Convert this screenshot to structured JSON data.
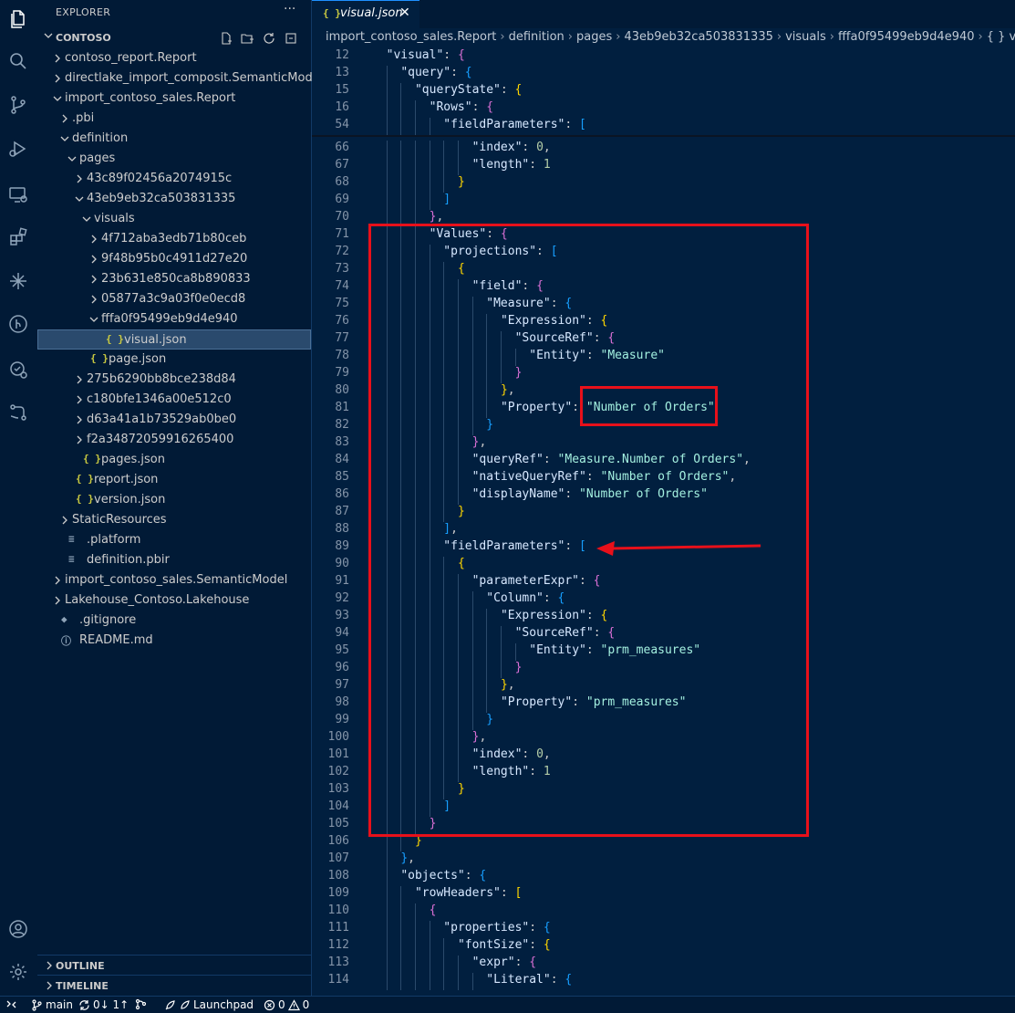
{
  "sidebar": {
    "title": "EXPLORER",
    "more": "···",
    "folder": "CONTOSO",
    "items": [
      {
        "label": "contoso_report.Report",
        "chev": "right",
        "indent": 0
      },
      {
        "label": "directlake_import_composit.SemanticModel",
        "chev": "right",
        "indent": 0
      },
      {
        "label": "import_contoso_sales.Report",
        "chev": "down",
        "indent": 0
      },
      {
        "label": ".pbi",
        "chev": "right",
        "indent": 1
      },
      {
        "label": "definition",
        "chev": "down",
        "indent": 1
      },
      {
        "label": "pages",
        "chev": "down",
        "indent": 2
      },
      {
        "label": "43c89f02456a2074915c",
        "chev": "right",
        "indent": 3
      },
      {
        "label": "43eb9eb32ca503831335",
        "chev": "down",
        "indent": 3
      },
      {
        "label": "visuals",
        "chev": "down",
        "indent": 4
      },
      {
        "label": "4f712aba3edb71b80ceb",
        "chev": "right",
        "indent": 5
      },
      {
        "label": "9f48b95b0c4911d27e20",
        "chev": "right",
        "indent": 5
      },
      {
        "label": "23b631e850ca8b890833",
        "chev": "right",
        "indent": 5
      },
      {
        "label": "05877a3c9a03f0e0ecd8",
        "chev": "right",
        "indent": 5
      },
      {
        "label": "fffa0f95499eb9d4e940",
        "chev": "down",
        "indent": 5
      },
      {
        "label": "visual.json",
        "icon": "{ }",
        "indent": 6,
        "selected": true
      },
      {
        "label": "page.json",
        "icon": "{ }",
        "indent": 4
      },
      {
        "label": "275b6290bb8bce238d84",
        "chev": "right",
        "indent": 3
      },
      {
        "label": "c180bfe1346a00e512c0",
        "chev": "right",
        "indent": 3
      },
      {
        "label": "d63a41a1b73529ab0be0",
        "chev": "right",
        "indent": 3
      },
      {
        "label": "f2a34872059916265400",
        "chev": "right",
        "indent": 3
      },
      {
        "label": "pages.json",
        "icon": "{ }",
        "indent": 3
      },
      {
        "label": "report.json",
        "icon": "{ }",
        "indent": 2
      },
      {
        "label": "version.json",
        "icon": "{ }",
        "indent": 2
      },
      {
        "label": "StaticResources",
        "chev": "right",
        "indent": 1
      },
      {
        "label": ".platform",
        "icon": "≡",
        "indent": 1
      },
      {
        "label": "definition.pbir",
        "icon": "≡",
        "indent": 1
      },
      {
        "label": "import_contoso_sales.SemanticModel",
        "chev": "right",
        "indent": 0
      },
      {
        "label": "Lakehouse_Contoso.Lakehouse",
        "chev": "right",
        "indent": 0
      },
      {
        "label": ".gitignore",
        "icon": "◆",
        "indent": 0
      },
      {
        "label": "README.md",
        "icon": "ⓘ",
        "indent": 0
      }
    ],
    "outline": "OUTLINE",
    "timeline": "TIMELINE"
  },
  "editor": {
    "tab": {
      "icon": "{ }",
      "label": "visual.json",
      "close": "✕"
    },
    "breadcrumbs": [
      "import_contoso_sales.Report",
      "definition",
      "pages",
      "43eb9eb32ca503831335",
      "visuals",
      "fffa0f95499eb9d4e940",
      "{ } visual.json",
      "…"
    ],
    "sticky_lines": [
      {
        "num": "12",
        "indent": 1,
        "parts": [
          [
            "k",
            "\"visual\""
          ],
          [
            "p",
            ": "
          ],
          [
            "b2",
            "{"
          ]
        ]
      },
      {
        "num": "13",
        "indent": 2,
        "parts": [
          [
            "k",
            "\"query\""
          ],
          [
            "p",
            ": "
          ],
          [
            "b3",
            "{"
          ]
        ]
      },
      {
        "num": "15",
        "indent": 3,
        "parts": [
          [
            "k",
            "\"queryState\""
          ],
          [
            "p",
            ": "
          ],
          [
            "b1",
            "{"
          ]
        ]
      },
      {
        "num": "16",
        "indent": 4,
        "parts": [
          [
            "k",
            "\"Rows\""
          ],
          [
            "p",
            ": "
          ],
          [
            "b2",
            "{"
          ]
        ]
      },
      {
        "num": "54",
        "indent": 5,
        "parts": [
          [
            "k",
            "\"fieldParameters\""
          ],
          [
            "p",
            ": "
          ],
          [
            "b3",
            "["
          ]
        ]
      }
    ],
    "lines": [
      {
        "num": "66",
        "indent": 7,
        "parts": [
          [
            "k",
            "\"index\""
          ],
          [
            "p",
            ": "
          ],
          [
            "n",
            "0"
          ],
          [
            "p",
            ","
          ]
        ]
      },
      {
        "num": "67",
        "indent": 7,
        "parts": [
          [
            "k",
            "\"length\""
          ],
          [
            "p",
            ": "
          ],
          [
            "n",
            "1"
          ]
        ]
      },
      {
        "num": "68",
        "indent": 6,
        "parts": [
          [
            "b1",
            "}"
          ]
        ]
      },
      {
        "num": "69",
        "indent": 5,
        "parts": [
          [
            "b3",
            "]"
          ]
        ]
      },
      {
        "num": "70",
        "indent": 4,
        "parts": [
          [
            "b2",
            "}"
          ],
          [
            "p",
            ","
          ]
        ]
      },
      {
        "num": "71",
        "indent": 4,
        "parts": [
          [
            "k",
            "\"Values\""
          ],
          [
            "p",
            ": "
          ],
          [
            "b2",
            "{"
          ]
        ]
      },
      {
        "num": "72",
        "indent": 5,
        "parts": [
          [
            "k",
            "\"projections\""
          ],
          [
            "p",
            ": "
          ],
          [
            "b3",
            "["
          ]
        ]
      },
      {
        "num": "73",
        "indent": 6,
        "parts": [
          [
            "b1",
            "{"
          ]
        ]
      },
      {
        "num": "74",
        "indent": 7,
        "parts": [
          [
            "k",
            "\"field\""
          ],
          [
            "p",
            ": "
          ],
          [
            "b2",
            "{"
          ]
        ]
      },
      {
        "num": "75",
        "indent": 8,
        "parts": [
          [
            "k",
            "\"Measure\""
          ],
          [
            "p",
            ": "
          ],
          [
            "b3",
            "{"
          ]
        ]
      },
      {
        "num": "76",
        "indent": 9,
        "parts": [
          [
            "k",
            "\"Expression\""
          ],
          [
            "p",
            ": "
          ],
          [
            "b1",
            "{"
          ]
        ]
      },
      {
        "num": "77",
        "indent": 10,
        "parts": [
          [
            "k",
            "\"SourceRef\""
          ],
          [
            "p",
            ": "
          ],
          [
            "b2",
            "{"
          ]
        ]
      },
      {
        "num": "78",
        "indent": 11,
        "parts": [
          [
            "k",
            "\"Entity\""
          ],
          [
            "p",
            ": "
          ],
          [
            "s",
            "\"Measure\""
          ]
        ]
      },
      {
        "num": "79",
        "indent": 10,
        "parts": [
          [
            "b2",
            "}"
          ]
        ]
      },
      {
        "num": "80",
        "indent": 9,
        "parts": [
          [
            "b1",
            "}"
          ],
          [
            "p",
            ","
          ]
        ]
      },
      {
        "num": "81",
        "indent": 9,
        "parts": [
          [
            "k",
            "\"Property\""
          ],
          [
            "p",
            ": "
          ],
          [
            "s",
            "\"Number of Orders\""
          ]
        ]
      },
      {
        "num": "82",
        "indent": 8,
        "parts": [
          [
            "b3",
            "}"
          ]
        ]
      },
      {
        "num": "83",
        "indent": 7,
        "parts": [
          [
            "b2",
            "}"
          ],
          [
            "p",
            ","
          ]
        ]
      },
      {
        "num": "84",
        "indent": 7,
        "parts": [
          [
            "k",
            "\"queryRef\""
          ],
          [
            "p",
            ": "
          ],
          [
            "s",
            "\"Measure.Number of Orders\""
          ],
          [
            "p",
            ","
          ]
        ]
      },
      {
        "num": "85",
        "indent": 7,
        "parts": [
          [
            "k",
            "\"nativeQueryRef\""
          ],
          [
            "p",
            ": "
          ],
          [
            "s",
            "\"Number of Orders\""
          ],
          [
            "p",
            ","
          ]
        ]
      },
      {
        "num": "86",
        "indent": 7,
        "parts": [
          [
            "k",
            "\"displayName\""
          ],
          [
            "p",
            ": "
          ],
          [
            "s",
            "\"Number of Orders\""
          ]
        ]
      },
      {
        "num": "87",
        "indent": 6,
        "parts": [
          [
            "b1",
            "}"
          ]
        ]
      },
      {
        "num": "88",
        "indent": 5,
        "parts": [
          [
            "b3",
            "]"
          ],
          [
            "p",
            ","
          ]
        ]
      },
      {
        "num": "89",
        "indent": 5,
        "parts": [
          [
            "k",
            "\"fieldParameters\""
          ],
          [
            "p",
            ": "
          ],
          [
            "b3",
            "["
          ]
        ]
      },
      {
        "num": "90",
        "indent": 6,
        "parts": [
          [
            "b1",
            "{"
          ]
        ]
      },
      {
        "num": "91",
        "indent": 7,
        "parts": [
          [
            "k",
            "\"parameterExpr\""
          ],
          [
            "p",
            ": "
          ],
          [
            "b2",
            "{"
          ]
        ]
      },
      {
        "num": "92",
        "indent": 8,
        "parts": [
          [
            "k",
            "\"Column\""
          ],
          [
            "p",
            ": "
          ],
          [
            "b3",
            "{"
          ]
        ]
      },
      {
        "num": "93",
        "indent": 9,
        "parts": [
          [
            "k",
            "\"Expression\""
          ],
          [
            "p",
            ": "
          ],
          [
            "b1",
            "{"
          ]
        ]
      },
      {
        "num": "94",
        "indent": 10,
        "parts": [
          [
            "k",
            "\"SourceRef\""
          ],
          [
            "p",
            ": "
          ],
          [
            "b2",
            "{"
          ]
        ]
      },
      {
        "num": "95",
        "indent": 11,
        "parts": [
          [
            "k",
            "\"Entity\""
          ],
          [
            "p",
            ": "
          ],
          [
            "s",
            "\"prm_measures\""
          ]
        ]
      },
      {
        "num": "96",
        "indent": 10,
        "parts": [
          [
            "b2",
            "}"
          ]
        ]
      },
      {
        "num": "97",
        "indent": 9,
        "parts": [
          [
            "b1",
            "}"
          ],
          [
            "p",
            ","
          ]
        ]
      },
      {
        "num": "98",
        "indent": 9,
        "parts": [
          [
            "k",
            "\"Property\""
          ],
          [
            "p",
            ": "
          ],
          [
            "s",
            "\"prm_measures\""
          ]
        ]
      },
      {
        "num": "99",
        "indent": 8,
        "parts": [
          [
            "b3",
            "}"
          ]
        ]
      },
      {
        "num": "100",
        "indent": 7,
        "parts": [
          [
            "b2",
            "}"
          ],
          [
            "p",
            ","
          ]
        ]
      },
      {
        "num": "101",
        "indent": 7,
        "parts": [
          [
            "k",
            "\"index\""
          ],
          [
            "p",
            ": "
          ],
          [
            "n",
            "0"
          ],
          [
            "p",
            ","
          ]
        ]
      },
      {
        "num": "102",
        "indent": 7,
        "parts": [
          [
            "k",
            "\"length\""
          ],
          [
            "p",
            ": "
          ],
          [
            "n",
            "1"
          ]
        ]
      },
      {
        "num": "103",
        "indent": 6,
        "parts": [
          [
            "b1",
            "}"
          ]
        ]
      },
      {
        "num": "104",
        "indent": 5,
        "parts": [
          [
            "b3",
            "]"
          ]
        ]
      },
      {
        "num": "105",
        "indent": 4,
        "parts": [
          [
            "b2",
            "}"
          ]
        ]
      },
      {
        "num": "106",
        "indent": 3,
        "parts": [
          [
            "b1",
            "}"
          ]
        ]
      },
      {
        "num": "107",
        "indent": 2,
        "parts": [
          [
            "b3",
            "}"
          ],
          [
            "p",
            ","
          ]
        ]
      },
      {
        "num": "108",
        "indent": 2,
        "parts": [
          [
            "k",
            "\"objects\""
          ],
          [
            "p",
            ": "
          ],
          [
            "b3",
            "{"
          ]
        ]
      },
      {
        "num": "109",
        "indent": 3,
        "parts": [
          [
            "k",
            "\"rowHeaders\""
          ],
          [
            "p",
            ": "
          ],
          [
            "b1",
            "["
          ]
        ]
      },
      {
        "num": "110",
        "indent": 4,
        "parts": [
          [
            "b2",
            "{"
          ]
        ]
      },
      {
        "num": "111",
        "indent": 5,
        "parts": [
          [
            "k",
            "\"properties\""
          ],
          [
            "p",
            ": "
          ],
          [
            "b3",
            "{"
          ]
        ]
      },
      {
        "num": "112",
        "indent": 6,
        "parts": [
          [
            "k",
            "\"fontSize\""
          ],
          [
            "p",
            ": "
          ],
          [
            "b1",
            "{"
          ]
        ]
      },
      {
        "num": "113",
        "indent": 7,
        "parts": [
          [
            "k",
            "\"expr\""
          ],
          [
            "p",
            ": "
          ],
          [
            "b2",
            "{"
          ]
        ]
      },
      {
        "num": "114",
        "indent": 8,
        "parts": [
          [
            "k",
            "\"Literal\""
          ],
          [
            "p",
            ": "
          ],
          [
            "b3",
            "{"
          ]
        ]
      }
    ]
  },
  "statusbar": {
    "branch": "main",
    "sync": "0↓ 1↑",
    "launchpad": "Launchpad",
    "errors": "0",
    "warnings": "0"
  },
  "colors": {
    "editor_bg": "#011f3f",
    "sidebar_bg": "#011a36",
    "annotation_red": "#e8101a",
    "selection": "#2a4a6d"
  }
}
